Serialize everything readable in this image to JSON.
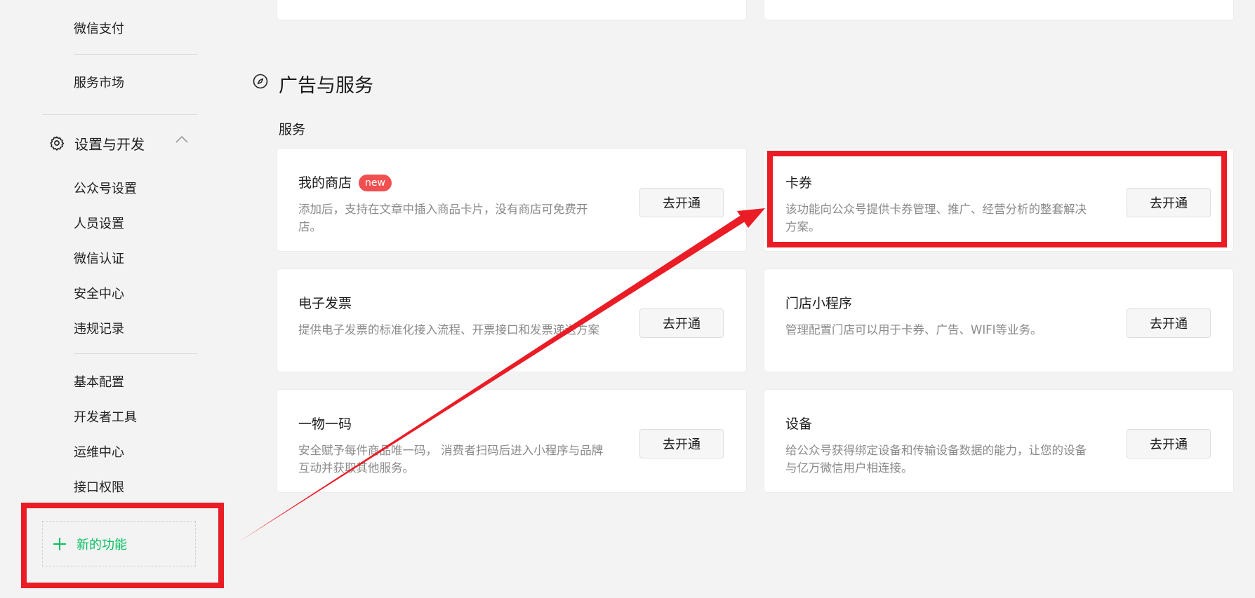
{
  "sidebar": {
    "top_items": [
      "微信支付",
      "服务市场"
    ],
    "group": {
      "title": "设置与开发",
      "icon": "gear-icon",
      "chevron": "chevron-up-icon"
    },
    "settings_items": [
      "公众号设置",
      "人员设置",
      "微信认证",
      "安全中心",
      "违规记录"
    ],
    "dev_items": [
      "基本配置",
      "开发者工具",
      "运维中心",
      "接口权限"
    ],
    "new_function": {
      "label": "新的功能",
      "icon": "plus-icon"
    }
  },
  "main": {
    "section_title": "广告与服务",
    "section_icon": "compass-icon",
    "sub_title": "服务",
    "cards": [
      {
        "title": "我的商店",
        "badge": "new",
        "desc": "添加后，支持在文章中插入商品卡片，没有商店可免费开店。",
        "button": "去开通"
      },
      {
        "title": "卡券",
        "desc": "该功能向公众号提供卡券管理、推广、经营分析的整套解决方案。",
        "button": "去开通"
      },
      {
        "title": "电子发票",
        "desc": "提供电子发票的标准化接入流程、开票接口和发票递送方案",
        "button": "去开通"
      },
      {
        "title": "门店小程序",
        "desc": "管理配置门店可以用于卡券、广告、WIFI等业务。",
        "button": "去开通"
      },
      {
        "title": "一物一码",
        "desc": "安全赋予每件商品唯一码， 消费者扫码后进入小程序与品牌互动并获取其他服务。",
        "button": "去开通"
      },
      {
        "title": "设备",
        "desc": "给公众号获得绑定设备和传输设备数据的能力，让您的设备与亿万微信用户相连接。",
        "button": "去开通"
      }
    ]
  },
  "colors": {
    "accent": "#07c160",
    "highlight": "#ea1c25",
    "badge": "#f05050"
  }
}
